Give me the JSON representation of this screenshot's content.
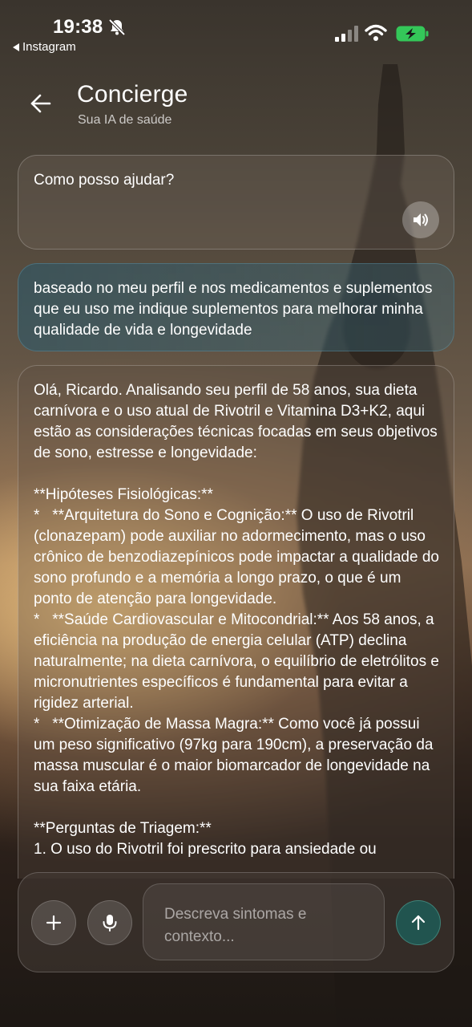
{
  "status_bar": {
    "time": "19:38",
    "back_app_label": "Instagram",
    "icons": [
      "bell-slash-icon",
      "signal-icon",
      "wifi-icon",
      "battery-charging-icon"
    ],
    "battery_color": "#34c759"
  },
  "header": {
    "title": "Concierge",
    "subtitle": "Sua IA de saúde",
    "back_icon": "arrow-left-icon"
  },
  "greeting": {
    "text": "Como posso ajudar?",
    "speaker_icon": "speaker-icon"
  },
  "user_message": {
    "text": "baseado no meu perfil e nos medicamentos e suplementos que eu uso me indique suplementos para melhorar minha qualidade de vida e longevidade"
  },
  "assistant_message": {
    "paragraphs": [
      "Olá, Ricardo. Analisando seu perfil de 58 anos, sua dieta carnívora e o uso atual de Rivotril e Vitamina D3+K2, aqui estão as considerações técnicas focadas em seus objetivos de sono, estresse e longevidade:",
      "",
      "**Hipóteses Fisiológicas:**",
      "*   **Arquitetura do Sono e Cognição:** O uso de Rivotril (clonazepam) pode auxiliar no adormecimento, mas o uso crônico de benzodiazepínicos pode impactar a qualidade do sono profundo e a memória a longo prazo, o que é um ponto de atenção para longevidade.",
      "*   **Saúde Cardiovascular e Mitocondrial:** Aos 58 anos, a eficiência na produção de energia celular (ATP) declina naturalmente; na dieta carnívora, o equilíbrio de eletrólitos e micronutrientes específicos é fundamental para evitar a rigidez arterial.",
      "*   **Otimização de Massa Magra:** Como você já possui um peso significativo (97kg para 190cm), a preservação da massa muscular é o maior biomarcador de longevidade na sua faixa etária.",
      "",
      "**Perguntas de Triagem:**",
      "1. O uso do Rivotril foi prescrito para ansiedade ou"
    ]
  },
  "composer": {
    "placeholder": "Descreva sintomas e contexto...",
    "plus_icon": "plus-icon",
    "mic_icon": "microphone-icon",
    "send_icon": "arrow-up-icon",
    "send_color": "#21544f"
  }
}
